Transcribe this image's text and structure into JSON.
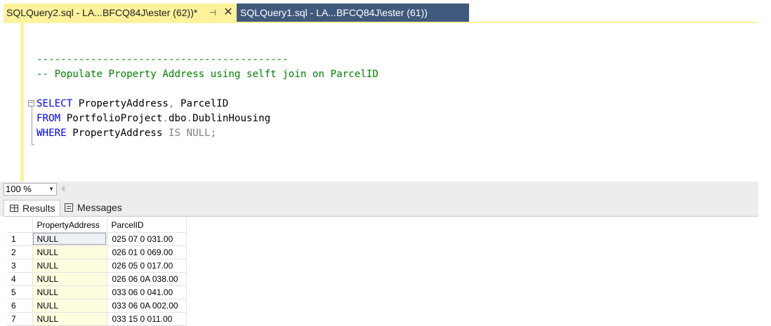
{
  "tabs": [
    {
      "label": "SQLQuery2.sql - LA...BFCQ84J\\ester (62))*",
      "pin_icon": "pin-icon",
      "close_icon": "close-icon",
      "active": true
    },
    {
      "label": "SQLQuery1.sql - LA...BFCQ84J\\ester (61))",
      "active": false
    }
  ],
  "editor": {
    "lines": [
      {
        "parts": [
          {
            "cls": "cm",
            "text": "------------------------------------------"
          }
        ]
      },
      {
        "parts": [
          {
            "cls": "cm",
            "text": "-- Populate Property Address using selft join on ParcelID"
          }
        ]
      },
      {
        "parts": [
          {
            "cls": "cm",
            "text": ""
          }
        ]
      },
      {
        "parts": [
          {
            "cls": "kw",
            "text": "SELECT"
          },
          {
            "cls": "id",
            "text": " PropertyAddress"
          },
          {
            "cls": "op",
            "text": ","
          },
          {
            "cls": "id",
            "text": " ParcelID"
          }
        ]
      },
      {
        "parts": [
          {
            "cls": "kw",
            "text": "FROM"
          },
          {
            "cls": "id",
            "text": " PortfolioProject"
          },
          {
            "cls": "op",
            "text": "."
          },
          {
            "cls": "id",
            "text": "dbo"
          },
          {
            "cls": "op",
            "text": "."
          },
          {
            "cls": "id",
            "text": "DublinHousing"
          }
        ]
      },
      {
        "parts": [
          {
            "cls": "kw",
            "text": "WHERE"
          },
          {
            "cls": "id",
            "text": " PropertyAddress "
          },
          {
            "cls": "op",
            "text": "IS NULL;"
          }
        ]
      }
    ]
  },
  "zoom": {
    "value": "100 %"
  },
  "results_tabs": {
    "results_label": "Results",
    "messages_label": "Messages"
  },
  "grid": {
    "columns": [
      "PropertyAddress",
      "ParcelID"
    ],
    "rows": [
      {
        "num": "1",
        "address": "NULL",
        "parcel": "025 07 0 031.00"
      },
      {
        "num": "2",
        "address": "NULL",
        "parcel": "026 01 0 069.00"
      },
      {
        "num": "3",
        "address": "NULL",
        "parcel": "026 05 0 017.00"
      },
      {
        "num": "4",
        "address": "NULL",
        "parcel": "026 06 0A 038.00"
      },
      {
        "num": "5",
        "address": "NULL",
        "parcel": "033 06 0 041.00"
      },
      {
        "num": "6",
        "address": "NULL",
        "parcel": "033 06 0A 002.00"
      },
      {
        "num": "7",
        "address": "NULL",
        "parcel": "033 15 0 011.00"
      }
    ]
  },
  "colors": {
    "active_tab": "#fff29d",
    "inactive_tab": "#41597d",
    "comment": "#008000",
    "keyword": "#0000ff"
  }
}
